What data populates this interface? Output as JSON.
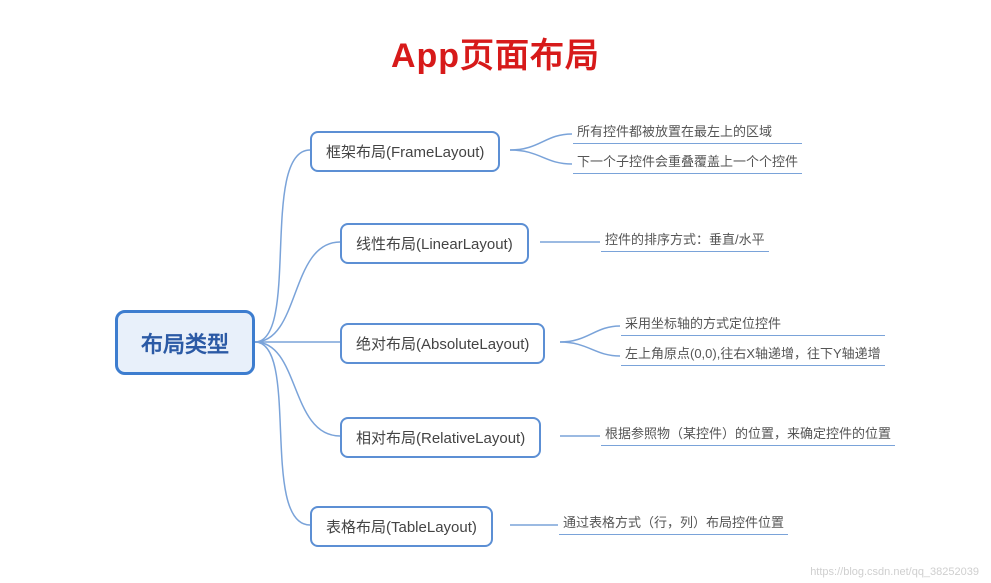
{
  "title": "App页面布局",
  "root": "布局类型",
  "branches": [
    {
      "label": "框架布局(FrameLayout)",
      "leaves": [
        "所有控件都被放置在最左上的区域",
        "下一个子控件会重叠覆盖上一个个控件"
      ]
    },
    {
      "label": "线性布局(LinearLayout)",
      "leaves": [
        "控件的排序方式：垂直/水平"
      ]
    },
    {
      "label": "绝对布局(AbsoluteLayout)",
      "leaves": [
        "采用坐标轴的方式定位控件",
        "左上角原点(0,0),往右X轴递增，往下Y轴递增"
      ]
    },
    {
      "label": "相对布局(RelativeLayout)",
      "leaves": [
        "根据参照物（某控件）的位置，来确定控件的位置"
      ]
    },
    {
      "label": "表格布局(TableLayout)",
      "leaves": [
        "通过表格方式（行，列）布局控件位置"
      ]
    }
  ],
  "watermark": "https://blog.csdn.net/qq_38252039"
}
